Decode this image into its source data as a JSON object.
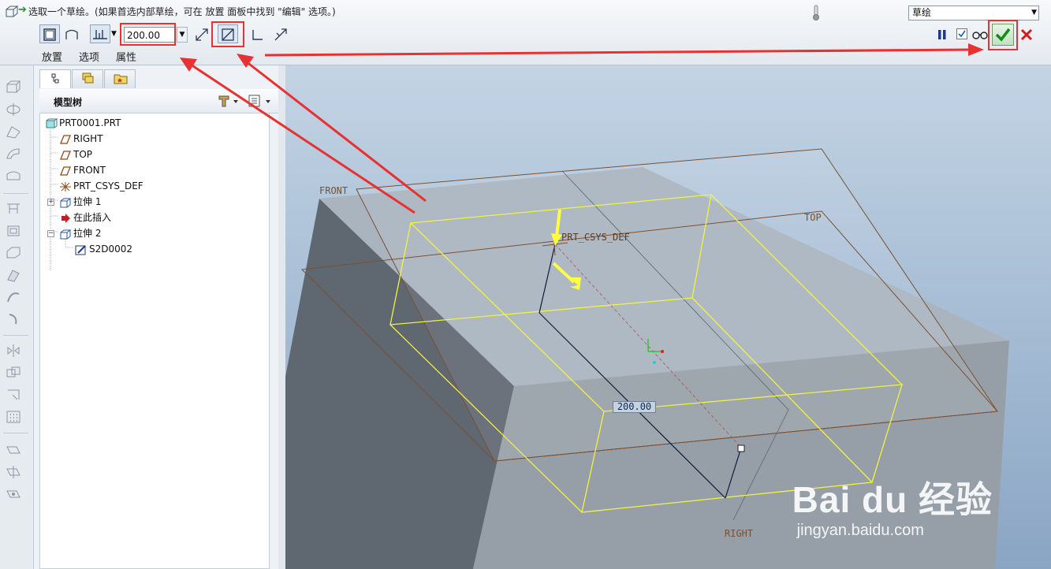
{
  "dashboard": {
    "prompt": "选取一个草绘。(如果首选内部草绘，可在 放置 面板中找到 \"编辑\" 选项。)",
    "depth_value": "200.00",
    "tabs": [
      {
        "label": "放置"
      },
      {
        "label": "选项"
      },
      {
        "label": "属性"
      }
    ],
    "mode_select": "草绘"
  },
  "model_tree": {
    "title": "模型树",
    "nodes": [
      {
        "label": "PRT0001.PRT",
        "icon": "part-icon"
      },
      {
        "label": "RIGHT",
        "icon": "datum-plane-icon"
      },
      {
        "label": "TOP",
        "icon": "datum-plane-icon"
      },
      {
        "label": "FRONT",
        "icon": "datum-plane-icon"
      },
      {
        "label": "PRT_CSYS_DEF",
        "icon": "csys-icon"
      },
      {
        "label": "拉伸 1",
        "icon": "extrude-icon"
      },
      {
        "label": "在此插入",
        "icon": "insert-here-icon"
      },
      {
        "label": "拉伸 2",
        "icon": "extrude-icon"
      },
      {
        "label": "S2D0002",
        "icon": "sketch-icon"
      }
    ]
  },
  "viewport": {
    "datum_labels": {
      "front": "FRONT",
      "top": "TOP",
      "right": "RIGHT",
      "csys": "PRT_CSYS_DEF"
    },
    "dimension": "200.00"
  },
  "watermark": {
    "main": "Bai du 经验",
    "sub": "jingyan.baidu.com"
  },
  "colors": {
    "annotation": "#e83232",
    "sketch": "#ffff33",
    "datum": "#7a5032"
  }
}
